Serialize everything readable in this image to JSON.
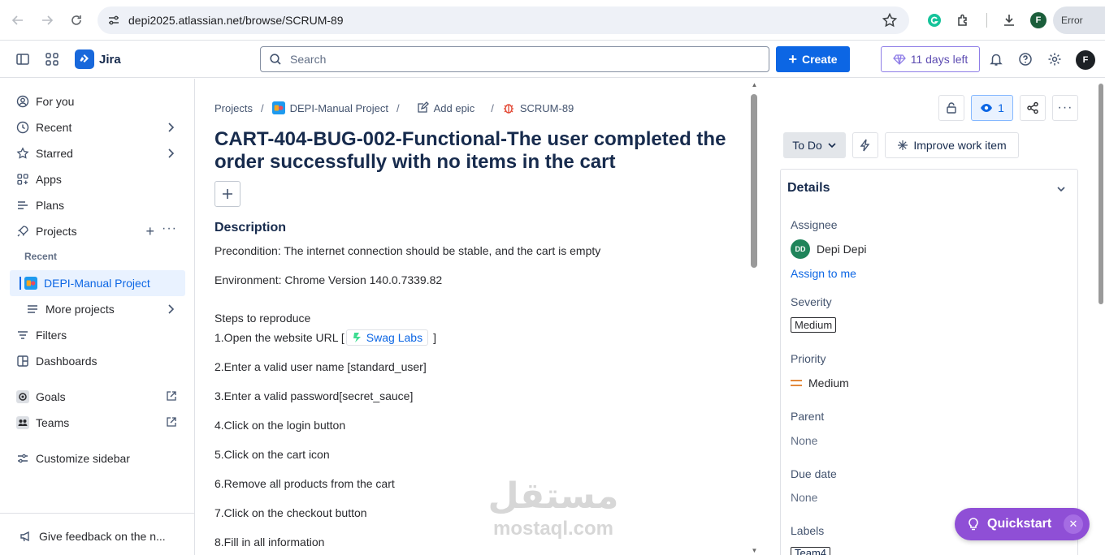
{
  "browser": {
    "url": "depi2025.atlassian.net/browse/SCRUM-89",
    "profile_initial": "F",
    "error_label": "Error"
  },
  "topnav": {
    "app_name": "Jira",
    "search_placeholder": "Search",
    "create_label": "Create",
    "trial_label": "11 days left",
    "avatar_initial": "F"
  },
  "sidebar": {
    "for_you": "For you",
    "recent": "Recent",
    "starred": "Starred",
    "apps": "Apps",
    "plans": "Plans",
    "projects": "Projects",
    "recent_header": "Recent",
    "project_name": "DEPI-Manual Project",
    "more_projects": "More projects",
    "filters": "Filters",
    "dashboards": "Dashboards",
    "goals": "Goals",
    "teams": "Teams",
    "customize": "Customize sidebar",
    "feedback": "Give feedback on the n..."
  },
  "breadcrumb": {
    "projects": "Projects",
    "project": "DEPI-Manual Project",
    "add_epic": "Add epic",
    "issue_key": "SCRUM-89"
  },
  "issue": {
    "title": "CART-404-BUG-002-Functional-The user completed the order successfully with no items in the cart",
    "description_heading": "Description",
    "precondition": "Precondition: The internet connection should be stable, and the cart is empty",
    "environment": "Environment: Chrome Version 140.0.7339.82",
    "steps_heading": "Steps to reproduce",
    "step1_prefix": "1.Open the website URL [",
    "step1_link": "Swag Labs",
    "step1_suffix": "]",
    "step2": "2.Enter a valid user name [standard_user]",
    "step3": "3.Enter a valid password[secret_sauce]",
    "step4": "4.Click on the login button",
    "step5": "5.Click on the cart icon",
    "step6": "6.Remove all products from the cart",
    "step7": "7.Click on the checkout button",
    "step8": "8.Fill in all information"
  },
  "panel": {
    "watch_count": "1",
    "status": "To Do",
    "improve_label": "Improve work item",
    "details_heading": "Details",
    "assignee_label": "Assignee",
    "assignee_initials": "DD",
    "assignee_name": "Depi Depi",
    "assign_to_me": "Assign to me",
    "severity_label": "Severity",
    "severity_value": "Medium",
    "priority_label": "Priority",
    "priority_value": "Medium",
    "parent_label": "Parent",
    "parent_value": "None",
    "due_label": "Due date",
    "due_value": "None",
    "labels_label": "Labels",
    "labels_value": "Team4"
  },
  "quickstart": {
    "label": "Quickstart"
  },
  "watermark": {
    "arabic": "مستقل",
    "latin": "mostaql.com"
  }
}
